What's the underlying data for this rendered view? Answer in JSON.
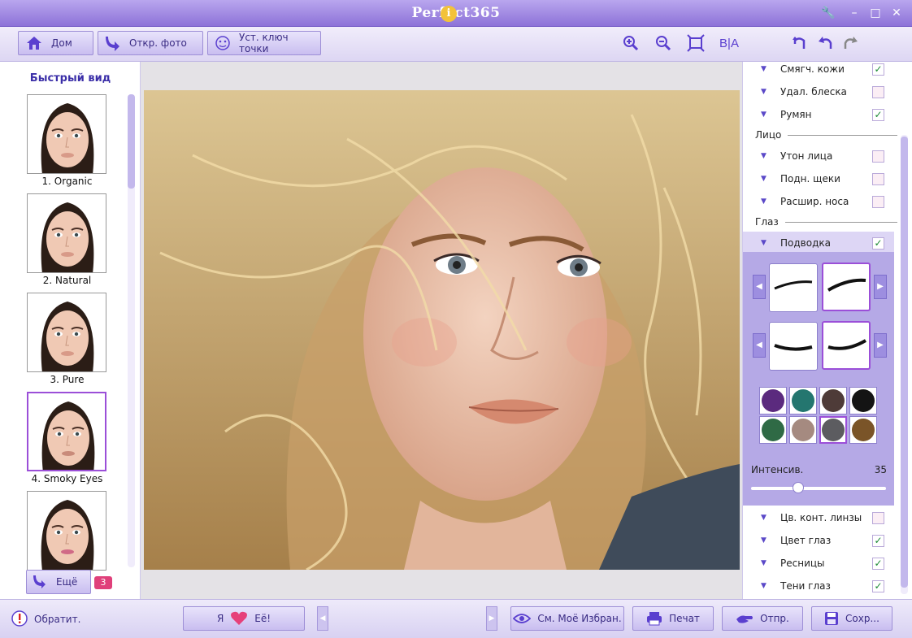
{
  "app": {
    "title": "Perfect365"
  },
  "toolbar": {
    "home_label": "Дом",
    "open_photo_label": "Откр. фото",
    "key_points_label": "Уст. ключ точки",
    "before_after_label": "B|A"
  },
  "left_panel": {
    "title": "Быстрый вид",
    "looks": [
      {
        "label": "1. Organic"
      },
      {
        "label": "2. Natural"
      },
      {
        "label": "3. Pure"
      },
      {
        "label": "4. Smoky Eyes"
      },
      {
        "label": ""
      }
    ],
    "selected_index": 3,
    "more_label": "Ещё",
    "more_badge": "3"
  },
  "right_panel": {
    "items_top": [
      {
        "label": "Смягч. кожи",
        "checked": true
      },
      {
        "label": "Удал. блеска",
        "checked": false
      },
      {
        "label": "Румян",
        "checked": true
      }
    ],
    "section_face": "Лицо",
    "items_face": [
      {
        "label": "Утон лица",
        "checked": false
      },
      {
        "label": "Подн. щеки",
        "checked": false
      },
      {
        "label": "Расшир. носа",
        "checked": false
      }
    ],
    "section_eyes": "Глаз",
    "eyeliner": {
      "label": "Подводка",
      "checked": true
    },
    "intensity_label": "Интенсив.",
    "intensity_value": "35",
    "intensity": 35,
    "swatches": [
      "#5b2a7e",
      "#24766f",
      "#4e3b38",
      "#141414",
      "#2f6a45",
      "#a58a80",
      "#5c5c60",
      "#7a5428"
    ],
    "selected_swatch": 6,
    "items_bottom": [
      {
        "label": "Цв. конт. линзы",
        "checked": false
      },
      {
        "label": "Цвет глаз",
        "checked": true
      },
      {
        "label": "Ресницы",
        "checked": true
      },
      {
        "label": "Тени глаз",
        "checked": true
      }
    ]
  },
  "bottom": {
    "feedback_label": "Обратит.",
    "love_left": "Я",
    "love_right": "Её!",
    "favorites_label": "См. Моё Избран.",
    "print_label": "Печат",
    "send_label": "Отпр.",
    "save_label": "Сохр..."
  },
  "colors": {
    "accent": "#8d72d8",
    "selected_border": "#9b4fd8",
    "check": "#1d8a36"
  }
}
